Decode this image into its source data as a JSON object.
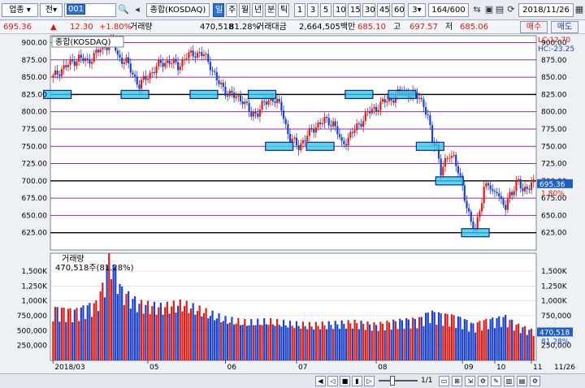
{
  "toolbar": {
    "market_label": "업종",
    "type_label": "전",
    "code_value": "001",
    "stock_name": "종합(KOSDAQ)",
    "period_tabs": [
      "일",
      "주",
      "월",
      "년",
      "분",
      "틱"
    ],
    "minute_options": [
      "1",
      "3",
      "5",
      "10",
      "15",
      "30",
      "45",
      "60"
    ],
    "tick_select": "3",
    "count_value": "164/600",
    "date_value": "2018/11/26"
  },
  "infobar": {
    "price": "695.36",
    "change": "12.30",
    "change_pct": "+1.80%",
    "volume_label": "거래량",
    "volume": "470,518",
    "volume_ratio": "81.28%",
    "amount_label": "거래대금",
    "amount": "2,664,505백만",
    "open": "685.10",
    "high_label": "고",
    "high": "697.57",
    "low_label": "저",
    "low": "685.06",
    "buy_label": "매수",
    "sell_label": "매도"
  },
  "chart_data": [
    {
      "type": "candlestick",
      "title": "종합(KOSDAQ)",
      "ylim": [
        600,
        910
      ],
      "y_ticks": [
        625,
        650,
        675,
        700,
        725,
        750,
        775,
        800,
        825,
        850,
        875,
        900
      ],
      "y_tick_labels": [
        "625.00",
        "650.00",
        "675.00",
        "700.00",
        "725.00",
        "750.00",
        "775.00",
        "800.00",
        "825.00",
        "850.00",
        "875.00",
        "900.00"
      ],
      "x_tick_labels": [
        "2018/03",
        "05",
        "06",
        "07",
        "08",
        "09",
        "10",
        "11"
      ],
      "lc_label": "LC:12.70",
      "hc_label": "HC:-23.25",
      "last_price_label": "695.36",
      "last_pct_label": "1.80%",
      "horizontal_lines_black": [
        825,
        700,
        625
      ],
      "horizontal_lines_purple": [
        900,
        875,
        850,
        800,
        775,
        750,
        725,
        675,
        650
      ],
      "support_resistance_boxes": [
        {
          "x_index": 2,
          "y": 825
        },
        {
          "x_index": 38,
          "y": 825
        },
        {
          "x_index": 70,
          "y": 825
        },
        {
          "x_index": 97,
          "y": 825
        },
        {
          "x_index": 105,
          "y": 750
        },
        {
          "x_index": 124,
          "y": 750
        },
        {
          "x_index": 142,
          "y": 825
        },
        {
          "x_index": 162,
          "y": 825
        },
        {
          "x_index": 175,
          "y": 750
        },
        {
          "x_index": 184,
          "y": 700
        },
        {
          "x_index": 196,
          "y": 625
        }
      ],
      "close_path": [
        [
          0,
          850
        ],
        [
          4,
          862
        ],
        [
          8,
          870
        ],
        [
          12,
          878
        ],
        [
          16,
          872
        ],
        [
          20,
          885
        ],
        [
          24,
          895
        ],
        [
          28,
          902
        ],
        [
          30,
          880
        ],
        [
          34,
          872
        ],
        [
          36,
          860
        ],
        [
          40,
          838
        ],
        [
          42,
          845
        ],
        [
          46,
          858
        ],
        [
          50,
          870
        ],
        [
          54,
          873
        ],
        [
          58,
          866
        ],
        [
          62,
          880
        ],
        [
          66,
          885
        ],
        [
          70,
          882
        ],
        [
          73,
          868
        ],
        [
          76,
          845
        ],
        [
          80,
          830
        ],
        [
          84,
          822
        ],
        [
          88,
          818
        ],
        [
          92,
          795
        ],
        [
          95,
          800
        ],
        [
          98,
          812
        ],
        [
          102,
          820
        ],
        [
          106,
          805
        ],
        [
          108,
          780
        ],
        [
          110,
          760
        ],
        [
          114,
          750
        ],
        [
          118,
          765
        ],
        [
          122,
          780
        ],
        [
          126,
          787
        ],
        [
          130,
          784
        ],
        [
          132,
          770
        ],
        [
          134,
          752
        ],
        [
          138,
          766
        ],
        [
          142,
          782
        ],
        [
          146,
          798
        ],
        [
          150,
          806
        ],
        [
          154,
          815
        ],
        [
          158,
          820
        ],
        [
          162,
          830
        ],
        [
          166,
          825
        ],
        [
          170,
          822
        ],
        [
          172,
          810
        ],
        [
          174,
          790
        ],
        [
          176,
          758
        ],
        [
          178,
          752
        ],
        [
          180,
          712
        ],
        [
          182,
          725
        ],
        [
          184,
          740
        ],
        [
          186,
          735
        ],
        [
          188,
          712
        ],
        [
          190,
          690
        ],
        [
          192,
          665
        ],
        [
          194,
          640
        ],
        [
          196,
          625
        ],
        [
          198,
          660
        ],
        [
          200,
          690
        ],
        [
          202,
          695
        ],
        [
          204,
          680
        ],
        [
          206,
          690
        ],
        [
          208,
          668
        ],
        [
          210,
          660
        ],
        [
          212,
          682
        ],
        [
          214,
          690
        ],
        [
          216,
          698
        ],
        [
          218,
          685
        ],
        [
          220,
          692
        ],
        [
          222,
          695
        ]
      ]
    },
    {
      "type": "bar",
      "title": "거래량",
      "value_label": "470,518주(81.28%)",
      "ylim": [
        0,
        1800
      ],
      "y_ticks": [
        250,
        500,
        750,
        1000,
        1250,
        1500
      ],
      "y_tick_labels": [
        "250,000",
        "500,000",
        "750,000",
        "1,000K",
        "1,250K",
        "1,500K"
      ],
      "last_value_label": "470,518",
      "last_pct_label": "81.28%",
      "bottom_right_label": "11/26",
      "volume_profile": [
        [
          0,
          820
        ],
        [
          10,
          780
        ],
        [
          20,
          900
        ],
        [
          24,
          1250
        ],
        [
          26,
          1700
        ],
        [
          28,
          1500
        ],
        [
          32,
          1100
        ],
        [
          40,
          900
        ],
        [
          50,
          850
        ],
        [
          60,
          900
        ],
        [
          70,
          780
        ],
        [
          80,
          650
        ],
        [
          90,
          600
        ],
        [
          100,
          620
        ],
        [
          110,
          580
        ],
        [
          120,
          560
        ],
        [
          130,
          580
        ],
        [
          140,
          600
        ],
        [
          150,
          560
        ],
        [
          160,
          620
        ],
        [
          170,
          650
        ],
        [
          175,
          760
        ],
        [
          180,
          720
        ],
        [
          185,
          700
        ],
        [
          190,
          650
        ],
        [
          195,
          560
        ],
        [
          200,
          620
        ],
        [
          210,
          680
        ],
        [
          215,
          560
        ],
        [
          222,
          470
        ]
      ]
    }
  ],
  "bottombar": {
    "zoom_label": "1/1"
  },
  "colors": {
    "up": "#d8201c",
    "down": "#1c42c8",
    "grid_purple": "#9a2aa8",
    "box_fill": "#38c8e8",
    "box_stroke": "#0a2a8a",
    "price_tag": "#1f5fc0"
  }
}
